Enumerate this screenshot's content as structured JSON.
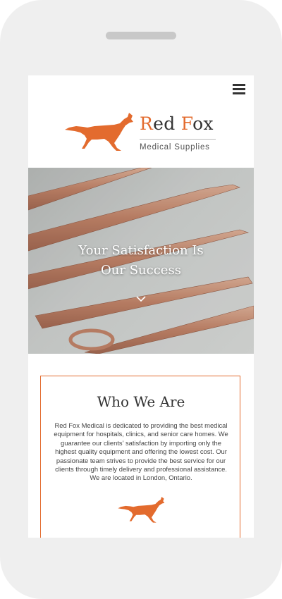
{
  "header": {
    "menu_icon": "hamburger-menu-icon",
    "logo_icon": "fox-icon",
    "brand_initial_1": "R",
    "brand_rest_1": "ed ",
    "brand_initial_2": "F",
    "brand_rest_2": "ox",
    "tagline": "Medical Supplies"
  },
  "hero": {
    "title_line1": "Your Satisfaction Is",
    "title_line2": "Our Success",
    "scroll_icon": "chevron-down-icon"
  },
  "about": {
    "title": "Who We Are",
    "body": "Red Fox Medical is dedicated to providing the best medical equipment for hospitals, clinics, and senior care homes. We guarantee our clients’ satisfaction by importing only the highest quality equipment and offering the lowest cost. Our passionate team strives to provide the best service for our clients through timely delivery and professional assistance. We are located in London, Ontario.",
    "icon": "fox-icon"
  },
  "colors": {
    "accent": "#e36b2e",
    "text_dark": "#333333",
    "device_frame": "#efefef"
  }
}
